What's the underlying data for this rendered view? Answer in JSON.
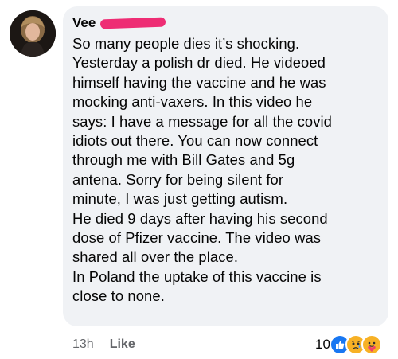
{
  "comment": {
    "author": "Vee",
    "lines": [
      "So many people dies it’s shocking.",
      "Yesterday a polish dr died. He videoed",
      "himself having the vaccine and he was",
      "mocking anti-vaxers. In this video he",
      "says: I have a message for all the covid",
      "idiots out there. You can now connect",
      "through me with Bill Gates and 5g",
      "antena. Sorry for being silent for",
      "minute, I was just getting autism.",
      "He died 9 days after having his second",
      "dose of Pfizer vaccine. The video was",
      "shared all over the place.",
      "In Poland the uptake of this vaccine is",
      "close to none."
    ]
  },
  "footer": {
    "timestamp": "13h",
    "like_label": "Like"
  },
  "reactions": {
    "count": "10",
    "icons": [
      "like-reaction-icon",
      "sad-reaction-icon",
      "care-reaction-icon"
    ]
  },
  "colors": {
    "bubble_bg": "#f0f2f5",
    "redaction": "#ee2d74",
    "like_blue": "#1877f2",
    "emoji_yellow": "#f7b125",
    "meta_text": "#65676b"
  }
}
